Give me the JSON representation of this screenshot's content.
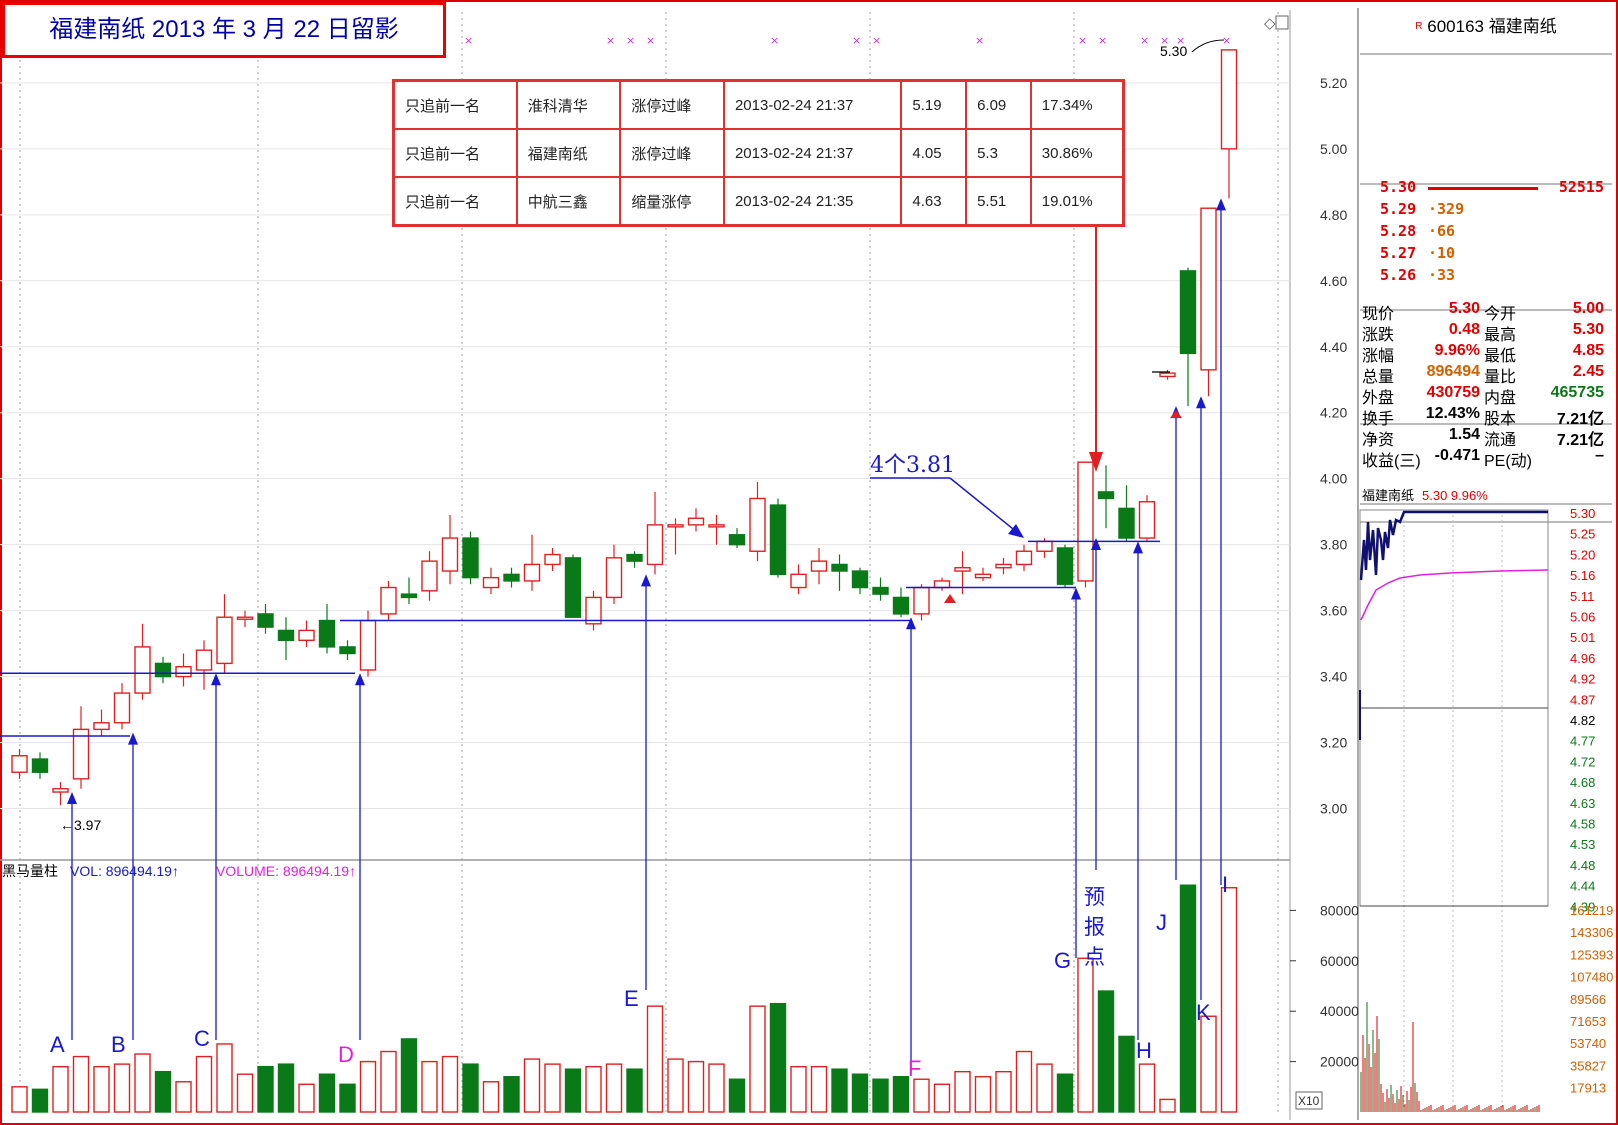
{
  "title": "福建南纸 2013 年 3 月 22 日留影",
  "picks_table": {
    "rows": [
      [
        "只追前一名",
        "淮科清华",
        "涨停过峰",
        "2013-02-24  21:37",
        "5.19",
        "6.09",
        "17.34%"
      ],
      [
        "只追前一名",
        "福建南纸",
        "涨停过峰",
        "2013-02-24  21:37",
        "4.05",
        "5.3",
        "30.86%"
      ],
      [
        "只追前一名",
        "中航三鑫",
        "缩量涨停",
        "2013-02-24  21:35",
        "4.63",
        "5.51",
        "19.01%"
      ]
    ]
  },
  "annotations": {
    "low_mark": "3.97",
    "high_mark": "5.30",
    "count_label": "4个3.81",
    "forecast_label": [
      "预",
      "报",
      "点"
    ],
    "letters": [
      "A",
      "B",
      "C",
      "D",
      "E",
      "F",
      "G",
      "H",
      "J",
      "K",
      "I"
    ]
  },
  "volume_header": {
    "indicator": "黑马量柱",
    "vol_text": "VOL: 896494.19",
    "volume_text": "VOLUME: 896494.19"
  },
  "corner_label": "X10",
  "colors": {
    "up": "#e02020",
    "down": "#0a7a18",
    "ref": "#1818d0",
    "frame": "#e00000",
    "magenta": "#e020e0",
    "grid": "#a0a0a0"
  },
  "quote": {
    "code": "600163",
    "name": "福建南纸",
    "r_badge": "R",
    "orderbook": [
      {
        "price": "5.30",
        "vol": "52515"
      },
      {
        "price": "5.29",
        "vol": "329"
      },
      {
        "price": "5.28",
        "vol": "66"
      },
      {
        "price": "5.27",
        "vol": "10"
      },
      {
        "price": "5.26",
        "vol": "33"
      }
    ],
    "stats": [
      {
        "k1": "现价",
        "v1": "5.30",
        "k2": "今开",
        "v2": "5.00"
      },
      {
        "k1": "涨跌",
        "v1": "0.48",
        "k2": "最高",
        "v2": "5.30"
      },
      {
        "k1": "涨幅",
        "v1": "9.96%",
        "k2": "最低",
        "v2": "4.85"
      },
      {
        "k1": "总量",
        "v1": "896494",
        "k2": "量比",
        "v2": "2.45"
      },
      {
        "k1": "外盘",
        "v1": "430759",
        "k2": "内盘",
        "v2": "465735"
      },
      {
        "k1": "换手",
        "v1": "12.43%",
        "k2": "股本",
        "v2": "7.21亿"
      },
      {
        "k1": "净资",
        "v1": "1.54",
        "k2": "流通",
        "v2": "7.21亿"
      },
      {
        "k1": "收益(三)",
        "v1": "-0.471",
        "k2": "PE(动)",
        "v2": "–"
      }
    ],
    "mini_header": {
      "name": "福建南纸",
      "price": "5.30",
      "pct": "9.96%"
    },
    "mini_price_ticks": [
      "5.30",
      "5.25",
      "5.20",
      "5.16",
      "5.11",
      "5.06",
      "5.01",
      "4.96",
      "4.92",
      "4.87",
      "4.82",
      "4.77",
      "4.72",
      "4.68",
      "4.63",
      "4.58",
      "4.53",
      "4.48",
      "4.44",
      "4.39"
    ],
    "mini_vol_ticks": [
      "161219",
      "143306",
      "125393",
      "107480",
      "89566",
      "71653",
      "53740",
      "35827",
      "17913"
    ]
  },
  "chart_data": {
    "type": "candlestick",
    "ylim": [
      2.85,
      5.33
    ],
    "yticks": [
      "5.20",
      "5.00",
      "4.80",
      "4.60",
      "4.40",
      "4.20",
      "4.00",
      "3.80",
      "3.60",
      "3.40",
      "3.20",
      "3.00"
    ],
    "volume_ylim": [
      0,
      100000
    ],
    "volume_ticks": [
      "80000",
      "60000",
      "40000",
      "20000"
    ],
    "candles": [
      {
        "o": 3.11,
        "c": 3.16,
        "h": 3.18,
        "l": 3.09,
        "v": 10000
      },
      {
        "o": 3.15,
        "c": 3.11,
        "h": 3.17,
        "l": 3.09,
        "v": 9000
      },
      {
        "o": 3.05,
        "c": 3.06,
        "h": 3.08,
        "l": 3.01,
        "v": 18000
      },
      {
        "o": 3.09,
        "c": 3.24,
        "h": 3.31,
        "l": 3.06,
        "v": 22000
      },
      {
        "o": 3.24,
        "c": 3.26,
        "h": 3.3,
        "l": 3.22,
        "v": 18000
      },
      {
        "o": 3.26,
        "c": 3.35,
        "h": 3.38,
        "l": 3.24,
        "v": 19000
      },
      {
        "o": 3.35,
        "c": 3.49,
        "h": 3.56,
        "l": 3.33,
        "v": 23000
      },
      {
        "o": 3.44,
        "c": 3.4,
        "h": 3.46,
        "l": 3.38,
        "v": 16000
      },
      {
        "o": 3.4,
        "c": 3.43,
        "h": 3.47,
        "l": 3.37,
        "v": 12000
      },
      {
        "o": 3.42,
        "c": 3.48,
        "h": 3.51,
        "l": 3.36,
        "v": 22000
      },
      {
        "o": 3.44,
        "c": 3.58,
        "h": 3.65,
        "l": 3.41,
        "v": 27000
      },
      {
        "o": 3.58,
        "c": 3.58,
        "h": 3.6,
        "l": 3.55,
        "v": 15000
      },
      {
        "o": 3.59,
        "c": 3.55,
        "h": 3.62,
        "l": 3.53,
        "v": 18000
      },
      {
        "o": 3.54,
        "c": 3.51,
        "h": 3.58,
        "l": 3.45,
        "v": 19000
      },
      {
        "o": 3.51,
        "c": 3.54,
        "h": 3.57,
        "l": 3.49,
        "v": 11000
      },
      {
        "o": 3.57,
        "c": 3.49,
        "h": 3.62,
        "l": 3.47,
        "v": 15000
      },
      {
        "o": 3.49,
        "c": 3.47,
        "h": 3.51,
        "l": 3.45,
        "v": 11000
      },
      {
        "o": 3.42,
        "c": 3.57,
        "h": 3.6,
        "l": 3.4,
        "v": 20000
      },
      {
        "o": 3.59,
        "c": 3.67,
        "h": 3.69,
        "l": 3.57,
        "v": 24000
      },
      {
        "o": 3.65,
        "c": 3.64,
        "h": 3.7,
        "l": 3.62,
        "v": 29000
      },
      {
        "o": 3.66,
        "c": 3.75,
        "h": 3.78,
        "l": 3.63,
        "v": 20000
      },
      {
        "o": 3.72,
        "c": 3.82,
        "h": 3.89,
        "l": 3.68,
        "v": 22000
      },
      {
        "o": 3.82,
        "c": 3.7,
        "h": 3.84,
        "l": 3.68,
        "v": 19000
      },
      {
        "o": 3.67,
        "c": 3.7,
        "h": 3.73,
        "l": 3.65,
        "v": 12000
      },
      {
        "o": 3.71,
        "c": 3.69,
        "h": 3.73,
        "l": 3.67,
        "v": 14000
      },
      {
        "o": 3.69,
        "c": 3.74,
        "h": 3.83,
        "l": 3.66,
        "v": 21000
      },
      {
        "o": 3.74,
        "c": 3.77,
        "h": 3.79,
        "l": 3.72,
        "v": 19000
      },
      {
        "o": 3.76,
        "c": 3.58,
        "h": 3.77,
        "l": 3.58,
        "v": 17000
      },
      {
        "o": 3.56,
        "c": 3.64,
        "h": 3.66,
        "l": 3.54,
        "v": 18000
      },
      {
        "o": 3.64,
        "c": 3.76,
        "h": 3.8,
        "l": 3.62,
        "v": 19000
      },
      {
        "o": 3.77,
        "c": 3.75,
        "h": 3.78,
        "l": 3.73,
        "v": 17000
      },
      {
        "o": 3.74,
        "c": 3.86,
        "h": 3.96,
        "l": 3.71,
        "v": 42000
      },
      {
        "o": 3.86,
        "c": 3.86,
        "h": 3.88,
        "l": 3.77,
        "v": 21000
      },
      {
        "o": 3.86,
        "c": 3.88,
        "h": 3.91,
        "l": 3.84,
        "v": 20000
      },
      {
        "o": 3.86,
        "c": 3.86,
        "h": 3.89,
        "l": 3.8,
        "v": 19000
      },
      {
        "o": 3.83,
        "c": 3.8,
        "h": 3.85,
        "l": 3.79,
        "v": 13000
      },
      {
        "o": 3.78,
        "c": 3.94,
        "h": 3.99,
        "l": 3.75,
        "v": 42000
      },
      {
        "o": 3.92,
        "c": 3.71,
        "h": 3.94,
        "l": 3.7,
        "v": 43000
      },
      {
        "o": 3.67,
        "c": 3.71,
        "h": 3.74,
        "l": 3.65,
        "v": 18000
      },
      {
        "o": 3.72,
        "c": 3.75,
        "h": 3.79,
        "l": 3.68,
        "v": 18000
      },
      {
        "o": 3.74,
        "c": 3.72,
        "h": 3.77,
        "l": 3.66,
        "v": 17000
      },
      {
        "o": 3.72,
        "c": 3.67,
        "h": 3.73,
        "l": 3.65,
        "v": 15000
      },
      {
        "o": 3.67,
        "c": 3.65,
        "h": 3.7,
        "l": 3.63,
        "v": 13000
      },
      {
        "o": 3.64,
        "c": 3.59,
        "h": 3.67,
        "l": 3.58,
        "v": 14000
      },
      {
        "o": 3.59,
        "c": 3.67,
        "h": 3.68,
        "l": 3.57,
        "v": 13000
      },
      {
        "o": 3.67,
        "c": 3.69,
        "h": 3.7,
        "l": 3.66,
        "v": 11000
      },
      {
        "o": 3.72,
        "c": 3.73,
        "h": 3.78,
        "l": 3.65,
        "v": 16000
      },
      {
        "o": 3.7,
        "c": 3.71,
        "h": 3.73,
        "l": 3.69,
        "v": 14000
      },
      {
        "o": 3.73,
        "c": 3.74,
        "h": 3.76,
        "l": 3.71,
        "v": 16000
      },
      {
        "o": 3.74,
        "c": 3.78,
        "h": 3.8,
        "l": 3.72,
        "v": 24000
      },
      {
        "o": 3.78,
        "c": 3.81,
        "h": 3.82,
        "l": 3.76,
        "v": 19000
      },
      {
        "o": 3.79,
        "c": 3.68,
        "h": 3.8,
        "l": 3.67,
        "v": 15000
      },
      {
        "o": 3.69,
        "c": 4.05,
        "h": 4.05,
        "l": 3.67,
        "v": 61000
      },
      {
        "o": 3.96,
        "c": 3.94,
        "h": 4.04,
        "l": 3.85,
        "v": 48000
      },
      {
        "o": 3.91,
        "c": 3.82,
        "h": 3.98,
        "l": 3.81,
        "v": 30000
      },
      {
        "o": 3.82,
        "c": 3.93,
        "h": 3.95,
        "l": 3.81,
        "v": 19000
      },
      {
        "o": 4.31,
        "c": 4.32,
        "h": 4.33,
        "l": 4.3,
        "v": 5000
      },
      {
        "o": 4.63,
        "c": 4.38,
        "h": 4.64,
        "l": 4.22,
        "v": 90000
      },
      {
        "o": 4.33,
        "c": 4.82,
        "h": 4.82,
        "l": 4.25,
        "v": 38000
      },
      {
        "o": 5.0,
        "c": 5.3,
        "h": 5.3,
        "l": 4.85,
        "v": 89000
      }
    ]
  }
}
